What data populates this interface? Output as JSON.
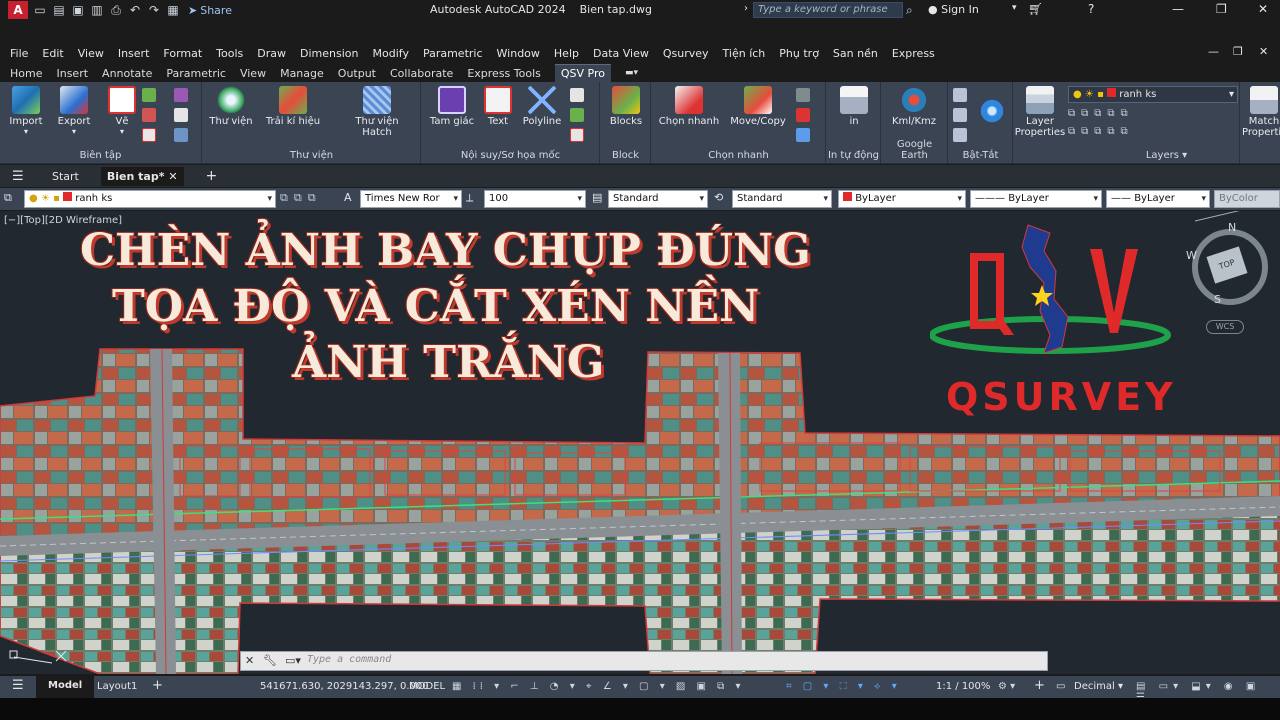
{
  "titlebar": {
    "app_icon": "A",
    "share_label": "Share",
    "app_name": "Autodesk AutoCAD 2024",
    "file_name": "Bien tap.dwg",
    "search_placeholder": "Type a keyword or phrase",
    "signin_label": "Sign In"
  },
  "menu": [
    "File",
    "Edit",
    "View",
    "Insert",
    "Format",
    "Tools",
    "Draw",
    "Dimension",
    "Modify",
    "Parametric",
    "Window",
    "Help",
    "Data View",
    "Qsurvey",
    "Tiện ích",
    "Phụ trợ",
    "San nền",
    "Express"
  ],
  "ribbon_tabs": [
    "Home",
    "Insert",
    "Annotate",
    "Parametric",
    "View",
    "Manage",
    "Output",
    "Collaborate",
    "Express Tools",
    "QSV Pro"
  ],
  "active_ribbon_tab": "QSV Pro",
  "ribbon": {
    "buttons": {
      "import": "Import",
      "export": "Export",
      "ve": "Vẽ",
      "thu_vien": "Thư viện",
      "trai_ki_hieu": "Trải kí hiệu",
      "thu_vien_hatch": "Thư viện Hatch",
      "tam_giac": "Tam giác",
      "text": "Text",
      "polyline": "Polyline",
      "blocks": "Blocks",
      "chon_nhanh": "Chọn nhanh",
      "move_copy": "Move/Copy",
      "in": "in",
      "kml_kmz": "Kml/Kmz",
      "layer_properties": "Layer Properties",
      "match_properties": "Match Properties"
    },
    "groups": {
      "bien_tap": "Biên tập",
      "thu_vien": "Thư viện",
      "noi_suy": "Nội suy/Sơ họa mốc",
      "block": "Block",
      "chon_nhanh": "Chọn nhanh",
      "in_tu_dong": "In tự động",
      "google_earth": "Google Earth",
      "bat_tat": "Bật-Tắt",
      "layers": "Layers"
    },
    "layer_current": "ranh ks"
  },
  "file_tabs": {
    "start": "Start",
    "active": "Bien tap*"
  },
  "propbar": {
    "layer": "ranh ks",
    "font": "Times New Ror",
    "scale": "100",
    "text_style": "Standard",
    "dim_style": "Standard",
    "color": "ByLayer",
    "linetype": "ByLayer",
    "lineweight": "ByLayer",
    "plotstyle": "ByColor"
  },
  "canvas": {
    "view_label": "[−][Top][2D Wireframe]",
    "headline": [
      "CHÈN ẢNH BAY CHỤP ĐÚNG",
      "TỌA ĐỘ VÀ CẮT XÉN NỀN",
      "ẢNH TRẮNG"
    ],
    "logo_text": "QSURVEY",
    "viewcube": {
      "n": "N",
      "w": "W",
      "s": "S",
      "face": "TOP",
      "wcs": "WCS"
    }
  },
  "command_placeholder": "Type a command",
  "statusbar": {
    "model_tab": "Model",
    "layout_tab": "Layout1",
    "coords": "541671.630, 2029143.297, 0.000",
    "mode": "MODEL",
    "scale": "1:1 / 100%",
    "units": "Decimal"
  },
  "colors": {
    "ribbon_bg": "#3b4453",
    "canvas_bg": "#212830",
    "accent_red": "#e02a2a",
    "logo_blue": "#1f3b8f",
    "logo_green": "#1fa14a"
  }
}
